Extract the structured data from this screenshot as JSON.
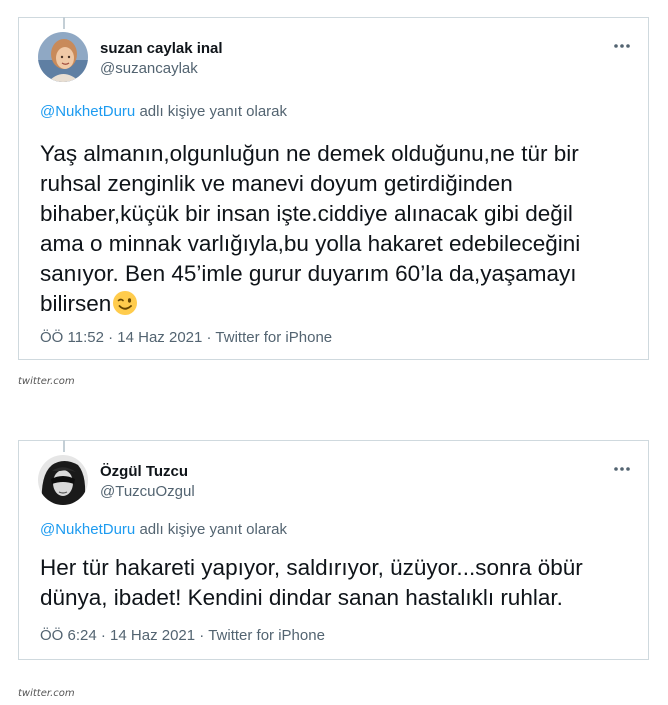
{
  "tweets": [
    {
      "display_name": "suzan caylak inal",
      "handle": "@suzancaylak",
      "reply_mention": "@NukhetDuru",
      "reply_suffix": " adlı kişiye yanıt olarak",
      "text": "Yaş almanın,olgunluğun ne demek olduğunu,ne tür bir\nruhsal zenginlik ve manevi doyum getirdiğinden\nbihaber,küçük bir insan işte.ciddiye alınacak gibi değil\nama o minnak varlığıyla,bu yolla hakaret edebileceğini\nsanıyor. Ben 45’imle gurur duyarım 60’la da,yaşamayı\nbilirsen",
      "emoji": "winking-face",
      "time": "ÖÖ 11:52",
      "date": "14 Haz 2021",
      "client": "Twitter for iPhone"
    },
    {
      "display_name": "Özgül Tuzcu",
      "handle": "@TuzcuOzgul",
      "reply_mention": "@NukhetDuru",
      "reply_suffix": " adlı kişiye yanıt olarak",
      "text": "Her tür hakareti yapıyor, saldırıyor, üzüyor...sonra öbür\ndünya, ibadet! Kendini dindar sanan hastalıklı ruhlar.",
      "time": "ÖÖ 6:24",
      "date": "14 Haz 2021",
      "client": "Twitter for iPhone"
    }
  ],
  "meta_separator": " · ",
  "source_label": "twitter.com",
  "colors": {
    "text": "#0f1419",
    "secondary": "#536471",
    "link": "#1d9bf0",
    "border": "#cfd9de"
  }
}
